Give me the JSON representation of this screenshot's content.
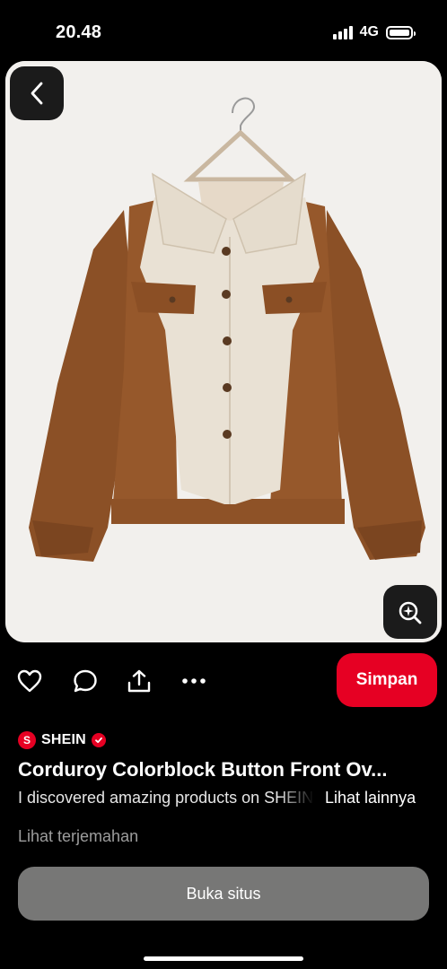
{
  "status_bar": {
    "time": "20.48",
    "network": "4G",
    "battery_level": 1.0
  },
  "pin": {
    "image_subject": "corduroy-colorblock-jacket-on-hanger",
    "brand": {
      "name": "SHEIN",
      "logo_letter": "S",
      "verified": true
    },
    "title": "Corduroy Colorblock Button Front Ov...",
    "description": "I discovered amazing products on SHEIN.com, come check them out!",
    "see_more": "Lihat lainnya",
    "translate": "Lihat terjemahan"
  },
  "actions": {
    "like_icon": "heart-icon",
    "comment_icon": "comment-icon",
    "share_icon": "share-icon",
    "more_icon": "more-icon",
    "save_label": "Simpan"
  },
  "visit_label": "Buka situs",
  "colors": {
    "accent": "#e60023",
    "background": "#000000",
    "visit_button": "#777776",
    "card": "#f2f0ed"
  }
}
